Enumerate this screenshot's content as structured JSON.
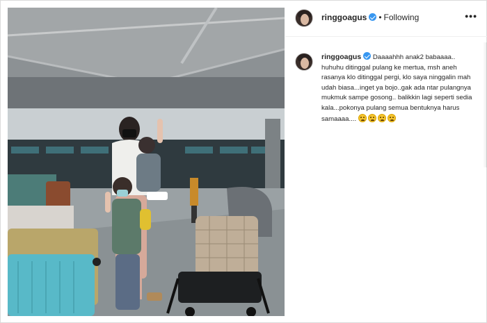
{
  "header": {
    "username": "ringgoagus",
    "separator": "•",
    "follow_state": "Following",
    "more_label": "•••"
  },
  "caption": {
    "username": "ringgoagus",
    "text": "Daaaahhh anak2 babaaaa.. huhuhu ditinggal pulang ke mertua, msh aneh rasanya klo ditinggal pergi, klo saya ninggalin mah udah biasa...inget ya bojo..gak ada ntar pulangnya mukmuk sampe gosong.. balikkin lagi seperti sedia kala...pokonya pulang semua bentuknya harus samaaaa....",
    "emojis": [
      "crying-face",
      "crying-face",
      "crying-face",
      "crying-face"
    ]
  },
  "colors": {
    "verified": "#3897f0",
    "border": "#dbdbdb",
    "text": "#262626"
  },
  "icons": {
    "verified": "verified-badge-icon",
    "more": "more-options-icon"
  }
}
